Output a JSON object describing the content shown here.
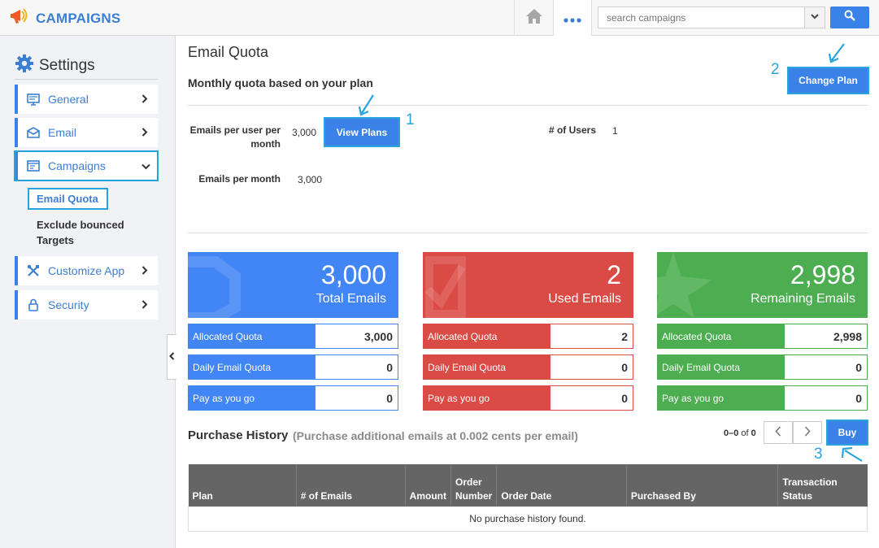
{
  "app": {
    "title": "CAMPAIGNS"
  },
  "topbar": {
    "search_placeholder": "search campaigns"
  },
  "sidebar": {
    "title": "Settings",
    "items": [
      {
        "label": "General",
        "icon": "monitor-icon"
      },
      {
        "label": "Email",
        "icon": "envelope-icon"
      },
      {
        "label": "Campaigns",
        "icon": "campaign-icon",
        "expanded": true
      },
      {
        "label": "Customize App",
        "icon": "tools-icon"
      },
      {
        "label": "Security",
        "icon": "lock-icon"
      }
    ],
    "subitems": [
      {
        "label": "Email Quota",
        "active": true
      },
      {
        "label": "Exclude bounced Targets"
      }
    ]
  },
  "main": {
    "page_title": "Email Quota",
    "section_title": "Monthly quota based on your plan",
    "change_plan_label": "Change Plan",
    "view_plans_label": "View Plans",
    "annotations": [
      "1",
      "2",
      "3"
    ],
    "info": {
      "emails_per_user_label": "Emails per user per month",
      "emails_per_user_value": "3,000",
      "users_label": "# of Users",
      "users_value": "1",
      "emails_per_month_label": "Emails per month",
      "emails_per_month_value": "3,000"
    },
    "cards": [
      {
        "value": "3,000",
        "label": "Total Emails",
        "color": "#4285f4",
        "border": "#4285f4",
        "rows": [
          {
            "label": "Allocated Quota",
            "value": "3,000"
          },
          {
            "label": "Daily Email Quota",
            "value": "0"
          },
          {
            "label": "Pay as you go",
            "value": "0"
          }
        ]
      },
      {
        "value": "2",
        "label": "Used Emails",
        "color": "#db4b45",
        "border": "#db4b45",
        "rows": [
          {
            "label": "Allocated Quota",
            "value": "2"
          },
          {
            "label": "Daily Email Quota",
            "value": "0"
          },
          {
            "label": "Pay as you go",
            "value": "0"
          }
        ]
      },
      {
        "value": "2,998",
        "label": "Remaining Emails",
        "color": "#4cae50",
        "border": "#4cae50",
        "rows": [
          {
            "label": "Allocated Quota",
            "value": "2,998"
          },
          {
            "label": "Daily Email Quota",
            "value": "0"
          },
          {
            "label": "Pay as you go",
            "value": "0"
          }
        ]
      }
    ],
    "purchase_history": {
      "title": "Purchase History",
      "subtitle": "(Purchase additional emails at 0.002 cents per email)",
      "pager_range": "0–0",
      "pager_of": "of",
      "pager_total": "0",
      "buy_label": "Buy",
      "columns": [
        "Plan",
        "# of Emails",
        "Amount",
        "Order Number",
        "Order Date",
        "Purchased By",
        "Transaction Status"
      ],
      "empty_text": "No purchase history found."
    }
  }
}
